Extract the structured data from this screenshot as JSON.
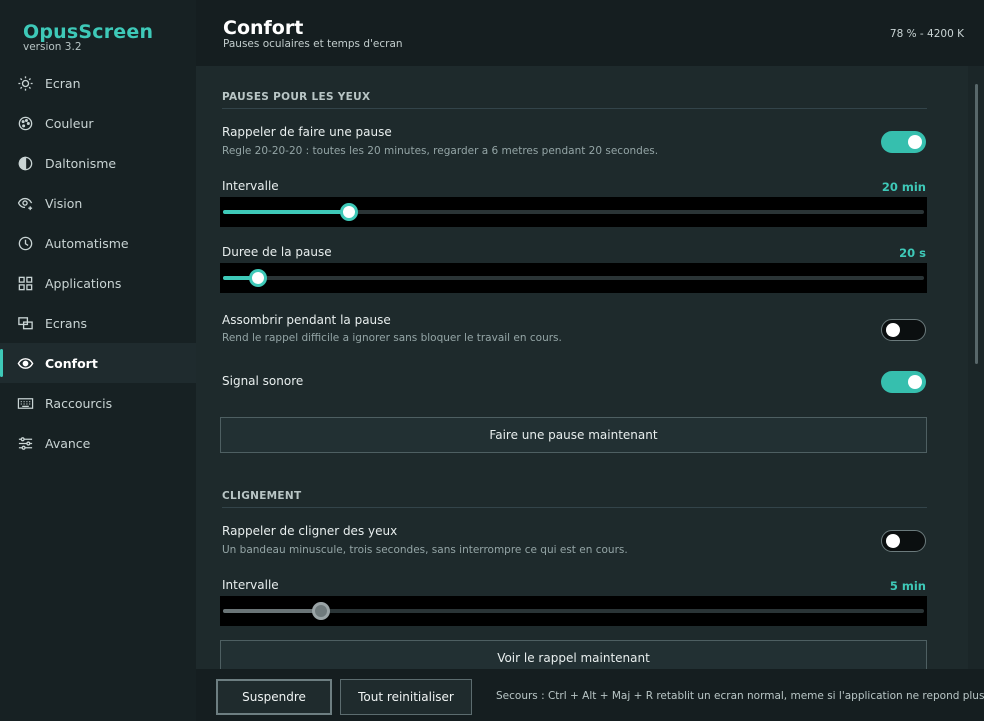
{
  "app": {
    "name": "OpusScreen",
    "version": "version 3.2"
  },
  "sidebar": {
    "items": [
      {
        "label": "Ecran",
        "icon": "sun-icon"
      },
      {
        "label": "Couleur",
        "icon": "palette-icon"
      },
      {
        "label": "Daltonisme",
        "icon": "half-circle-icon"
      },
      {
        "label": "Vision",
        "icon": "eye-plus-icon"
      },
      {
        "label": "Automatisme",
        "icon": "clock-icon"
      },
      {
        "label": "Applications",
        "icon": "grid-icon"
      },
      {
        "label": "Ecrans",
        "icon": "monitors-icon"
      },
      {
        "label": "Confort",
        "icon": "eye-icon",
        "active": true
      },
      {
        "label": "Raccourcis",
        "icon": "keyboard-icon"
      },
      {
        "label": "Avance",
        "icon": "sliders-icon"
      }
    ]
  },
  "header": {
    "title": "Confort",
    "subtitle": "Pauses oculaires et temps d'ecran",
    "status": "78 % - 4200 K"
  },
  "eye_breaks": {
    "title": "PAUSES POUR LES YEUX",
    "remind": {
      "label": "Rappeler de faire une pause",
      "desc": "Regle 20-20-20 : toutes les 20 minutes, regarder a 6 metres pendant 20 secondes.",
      "on": true
    },
    "interval": {
      "label": "Intervalle",
      "value": "20 min",
      "level": 0.18
    },
    "duration": {
      "label": "Duree de la pause",
      "value": "20 s",
      "level": 0.05
    },
    "dim": {
      "label": "Assombrir pendant la pause",
      "desc": "Rend le rappel difficile a ignorer sans bloquer le travail en cours.",
      "on": false
    },
    "sound": {
      "label": "Signal sonore",
      "on": true
    },
    "button": "Faire une pause maintenant"
  },
  "blink": {
    "title": "CLIGNEMENT",
    "remind": {
      "label": "Rappeler de cligner des yeux",
      "desc": "Un bandeau minuscule, trois secondes, sans interrompre ce qui est en cours.",
      "on": false
    },
    "interval": {
      "label": "Intervalle",
      "value": "5 min",
      "level": 0.14
    },
    "button": "Voir le rappel maintenant"
  },
  "footer": {
    "suspend": "Suspendre",
    "reset": "Tout reinitialiser",
    "note": "Secours : Ctrl + Alt + Maj + R retablit un ecran normal, meme si l'application ne repond plus."
  },
  "colors": {
    "accent": "#3ec9b8",
    "sidebar": "#172123",
    "panel": "#1e2a2c"
  }
}
